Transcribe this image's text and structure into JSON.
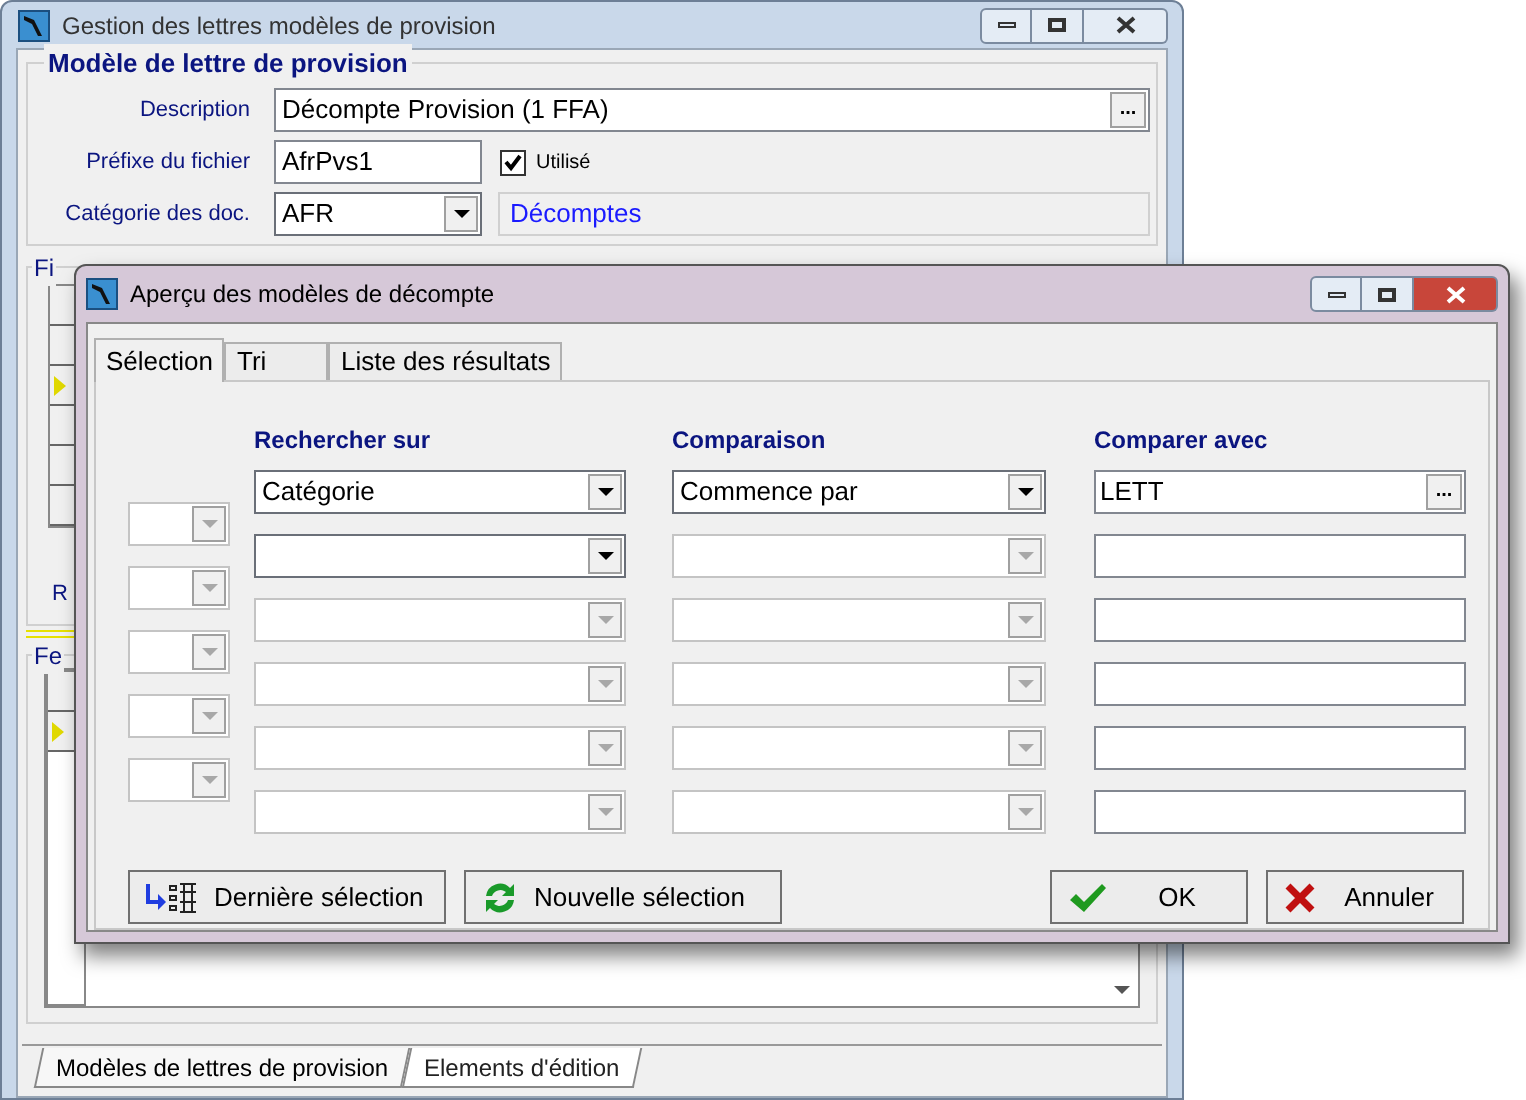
{
  "main_window": {
    "title": "Gestion des lettres modèles de provision",
    "group": {
      "legend": "Modèle de lettre de provision",
      "description": {
        "label": "Description",
        "value": "Décompte Provision (1 FFA)",
        "button": "..."
      },
      "prefix": {
        "label": "Préfixe du fichier",
        "value": "AfrPvs1"
      },
      "used": {
        "label": "Utilisé",
        "checked": true
      },
      "category": {
        "label": "Catégorie des doc.",
        "value": "AFR",
        "name": "Décomptes"
      }
    },
    "group_2": {
      "legend": "Fi",
      "label": "R"
    },
    "group_3": {
      "legend": "Fe"
    },
    "bottom_tabs": [
      {
        "label": "Modèles de lettres de provision",
        "selected": true
      },
      {
        "label": "Elements d'édition",
        "selected": false
      }
    ]
  },
  "dialog": {
    "title": "Aperçu des modèles de décompte",
    "tabs": [
      {
        "label": "Sélection",
        "selected": true
      },
      {
        "label": "Tri",
        "selected": false
      },
      {
        "label": "Liste des résultats",
        "selected": false
      }
    ],
    "headings": [
      "Rechercher sur",
      "Comparaison",
      "Comparer avec"
    ],
    "operators": [
      {
        "disabled": true
      },
      {
        "disabled": true
      },
      {
        "disabled": true
      },
      {
        "disabled": true
      },
      {
        "disabled": true
      }
    ],
    "criteria": [
      {
        "field": {
          "value": "Catégorie",
          "disabled": false
        },
        "comparison": {
          "value": "Commence par",
          "disabled": false
        },
        "compare_with": {
          "value": "LETT",
          "button": "..."
        }
      },
      {
        "field": {
          "disabled": false
        },
        "comparison": {
          "disabled": true
        }
      },
      {
        "field": {
          "disabled": true
        },
        "comparison": {
          "disabled": true
        }
      },
      {
        "field": {
          "disabled": true
        },
        "comparison": {
          "disabled": true
        }
      },
      {
        "field": {
          "disabled": true
        },
        "comparison": {
          "disabled": true
        }
      },
      {
        "field": {
          "disabled": true
        },
        "comparison": {
          "disabled": true
        }
      }
    ],
    "buttons": [
      {
        "kind": "last",
        "label": "Dernière sélection"
      },
      {
        "kind": "new",
        "label": "Nouvelle sélection"
      },
      {
        "kind": "ok",
        "label": "OK"
      },
      {
        "kind": "cancel",
        "label": "Annuler"
      }
    ]
  }
}
